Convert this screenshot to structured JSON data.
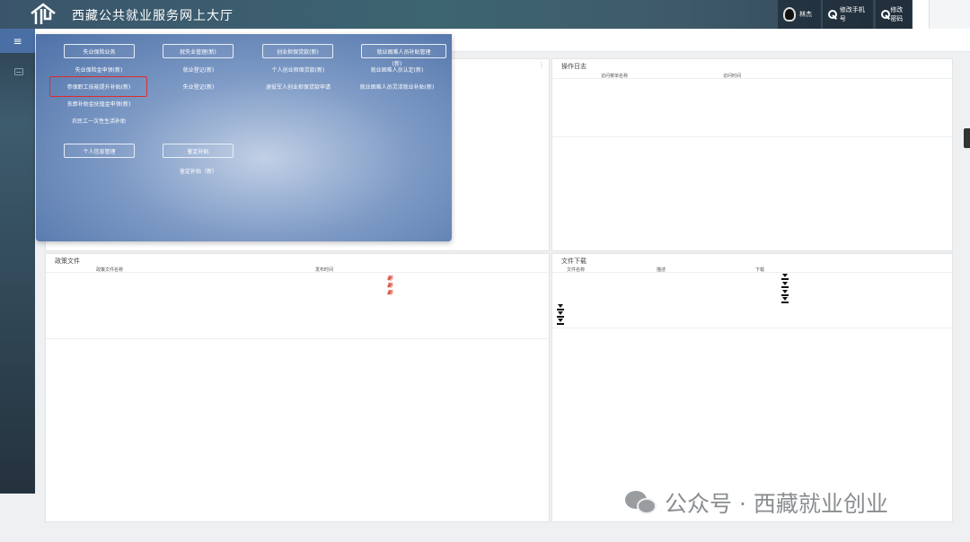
{
  "header": {
    "title": "西藏公共就业服务网上大厅",
    "user_name": "林杰",
    "change_phone": "修改手机号",
    "change_pwd": "修改密码"
  },
  "sidebar": {
    "menu_icon": "menu-icon",
    "item_icon": "print-icon"
  },
  "mega_menu": {
    "categories": [
      "失业保险业务",
      "就失业管理(新)",
      "创业担保贷款(新)",
      "就业困难人员补贴管理",
      "个人信息管理",
      "鉴定补贴"
    ],
    "col1": [
      "失业保险金申领(新)",
      "参保职工技能提升补贴(新)",
      "丧葬补助金抚恤金申领(新)",
      "农民工一次性生活补助"
    ],
    "col2": [
      "就业登记(新)",
      "失业登记(新)"
    ],
    "col3": [
      "个人创业担保贷款(新)",
      "退役军人创业担保贷款申请"
    ],
    "col4": [
      "(新)",
      "就业困难人员认定(新)",
      "就业困难人员灵活就业补贴(新)"
    ],
    "appraisal": [
      "鉴定补贴（新）"
    ],
    "highlighted": "参保职工技能提升补贴(新)"
  },
  "panels": {
    "operation_log": {
      "title": "操作日志",
      "col1": "访问菜单名称",
      "col2": "访问时间"
    },
    "policy": {
      "title": "政策文件",
      "col1": "政策文件名称",
      "col2": "发布时间",
      "new_tag": "新"
    },
    "download": {
      "title": "文件下载",
      "col1": "文件名称",
      "col2": "描述",
      "col3": "下载"
    }
  },
  "watermark": {
    "text": "公众号 · 西藏就业创业",
    "icon": "wechat-icon"
  },
  "colors": {
    "accent": "#4a6fa5",
    "highlight": "#e02b2b",
    "new_tag": "#d4321e"
  }
}
